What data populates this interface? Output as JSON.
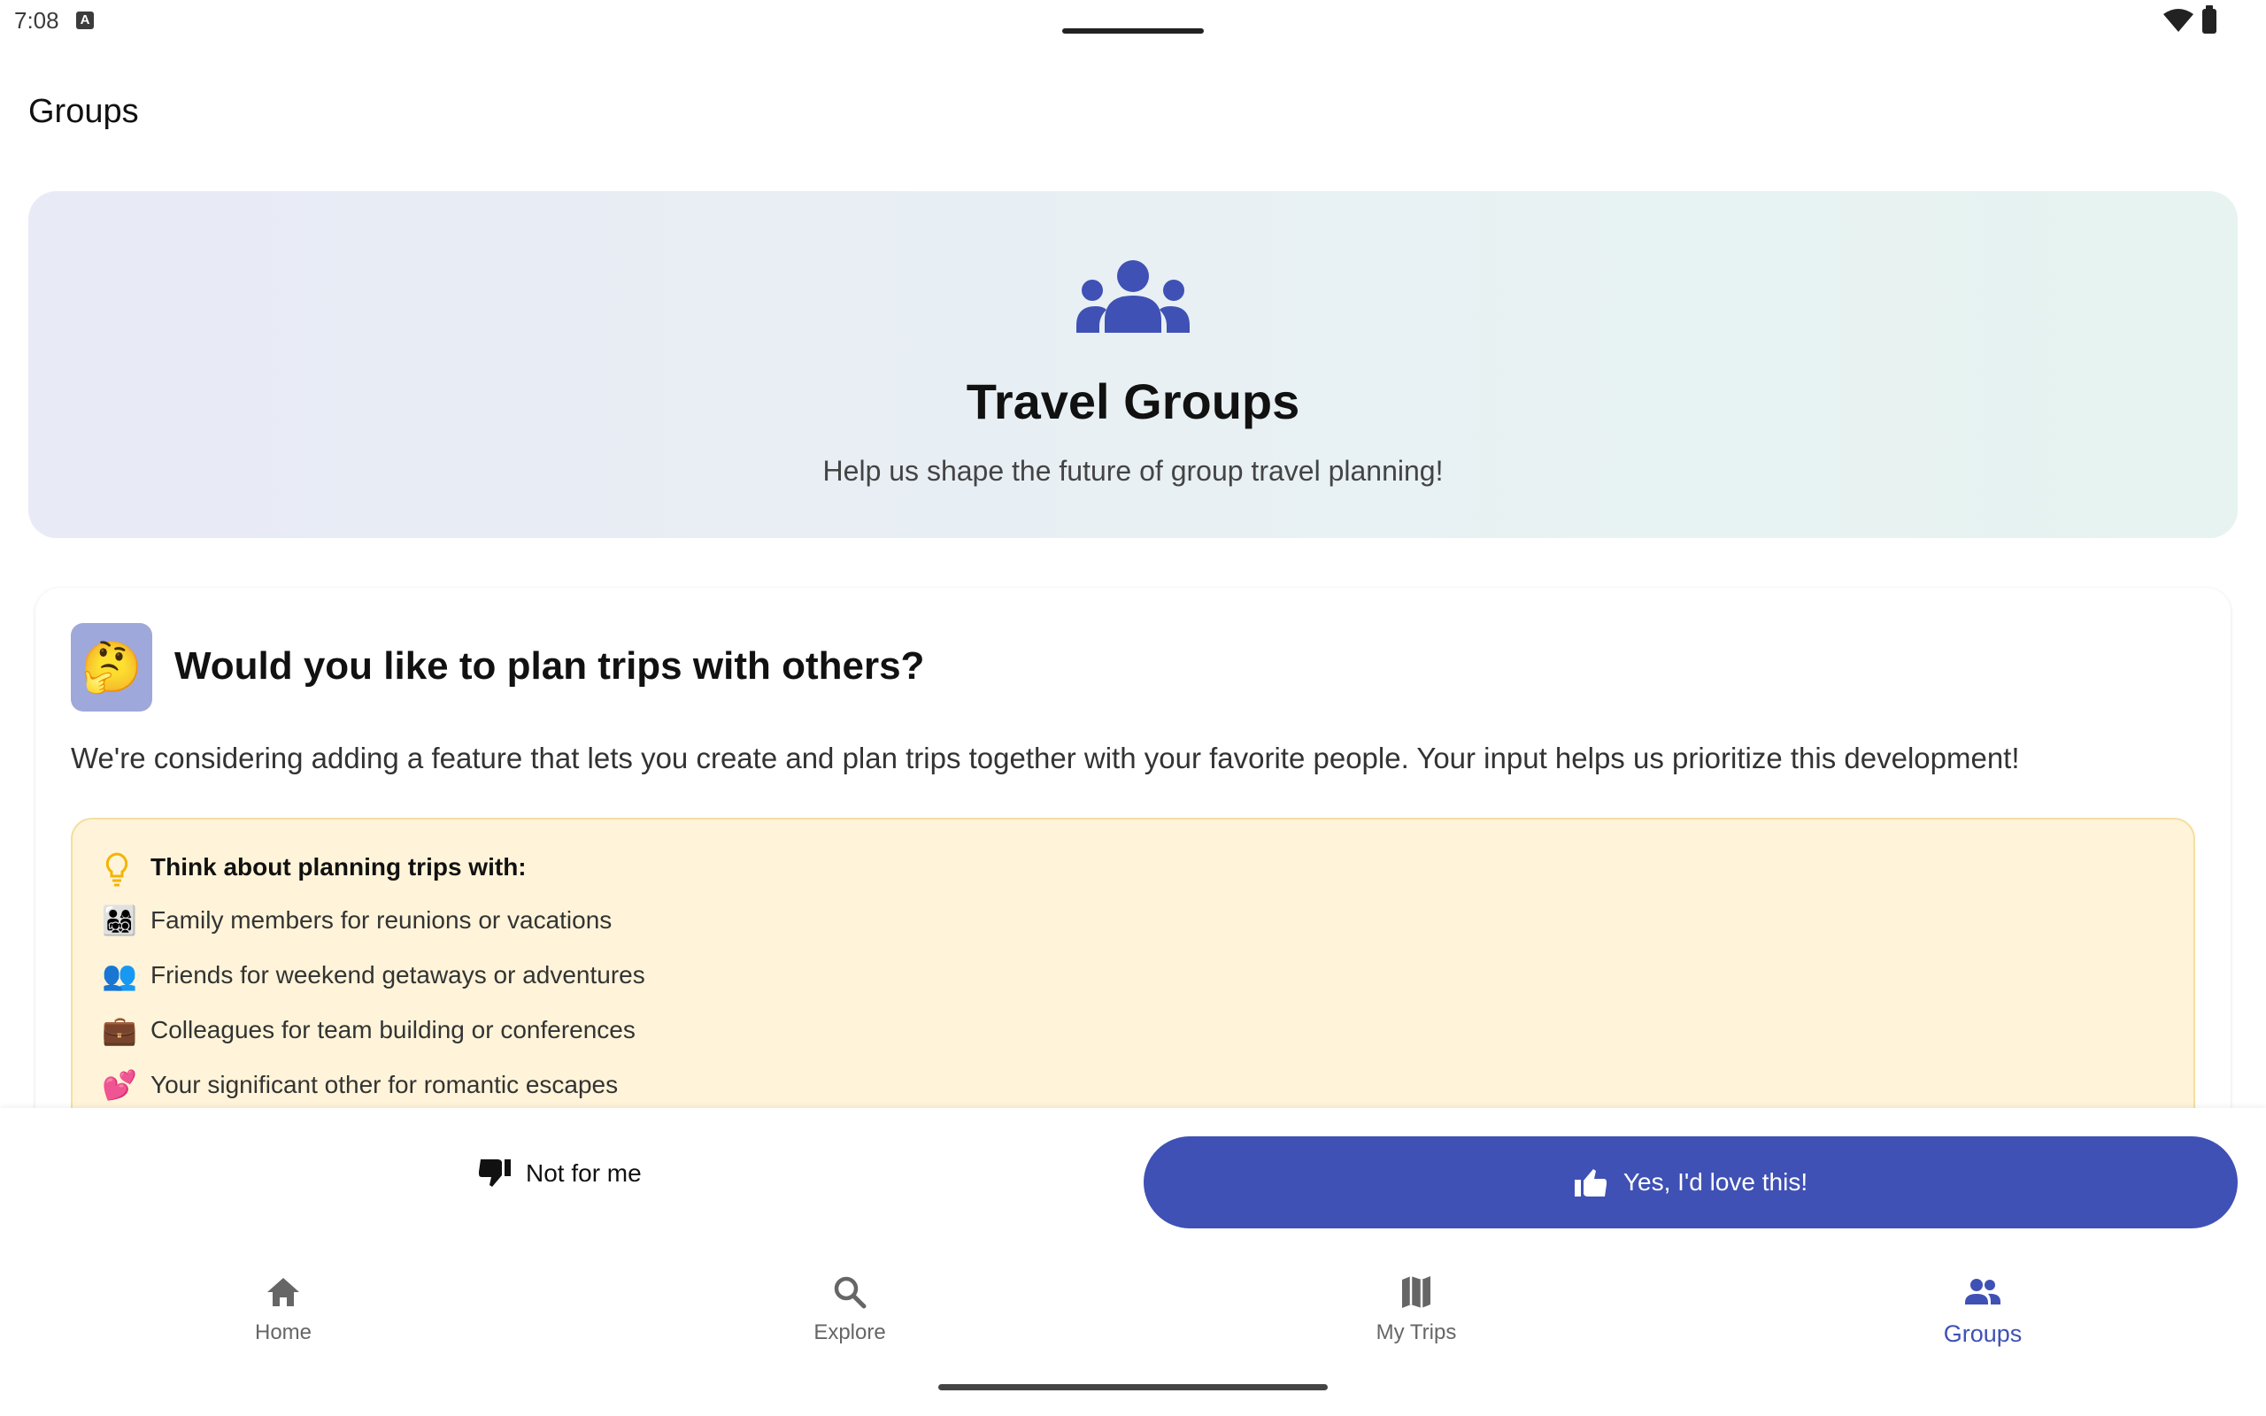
{
  "status_bar": {
    "time": "7:08",
    "notification_icon": "A"
  },
  "header": {
    "title": "Groups"
  },
  "hero": {
    "icon": "groups-icon",
    "title": "Travel Groups",
    "subtitle": "Help us shape the future of group travel planning!"
  },
  "card": {
    "emoji": "🤔",
    "title": "Would you like to plan trips with others?",
    "description": "We're considering adding a feature that lets you create and plan trips together with your favorite people. Your input helps us prioritize this development!",
    "tips": {
      "heading": "Think about planning trips with:",
      "items": [
        {
          "emoji": "👨‍👩‍👧‍👦",
          "text": "Family members for reunions or vacations"
        },
        {
          "emoji": "👥",
          "text": "Friends for weekend getaways or adventures"
        },
        {
          "emoji": "💼",
          "text": "Colleagues for team building or conferences"
        },
        {
          "emoji": "💕",
          "text": "Your significant other for romantic escapes"
        }
      ]
    }
  },
  "actions": {
    "decline_label": "Not for me",
    "accept_label": "Yes, I'd love this!"
  },
  "bottom_nav": {
    "items": [
      {
        "label": "Home",
        "icon": "home-icon"
      },
      {
        "label": "Explore",
        "icon": "search-icon"
      },
      {
        "label": "My Trips",
        "icon": "map-icon"
      },
      {
        "label": "Groups",
        "icon": "groups-icon",
        "active": true
      }
    ]
  },
  "colors": {
    "primary": "#3f51b5",
    "hero_gradient_start": "#e8eaf6",
    "hero_gradient_end": "#e6f3f0",
    "tips_background": "#fff4d9",
    "tips_icon": "#f4b400"
  }
}
